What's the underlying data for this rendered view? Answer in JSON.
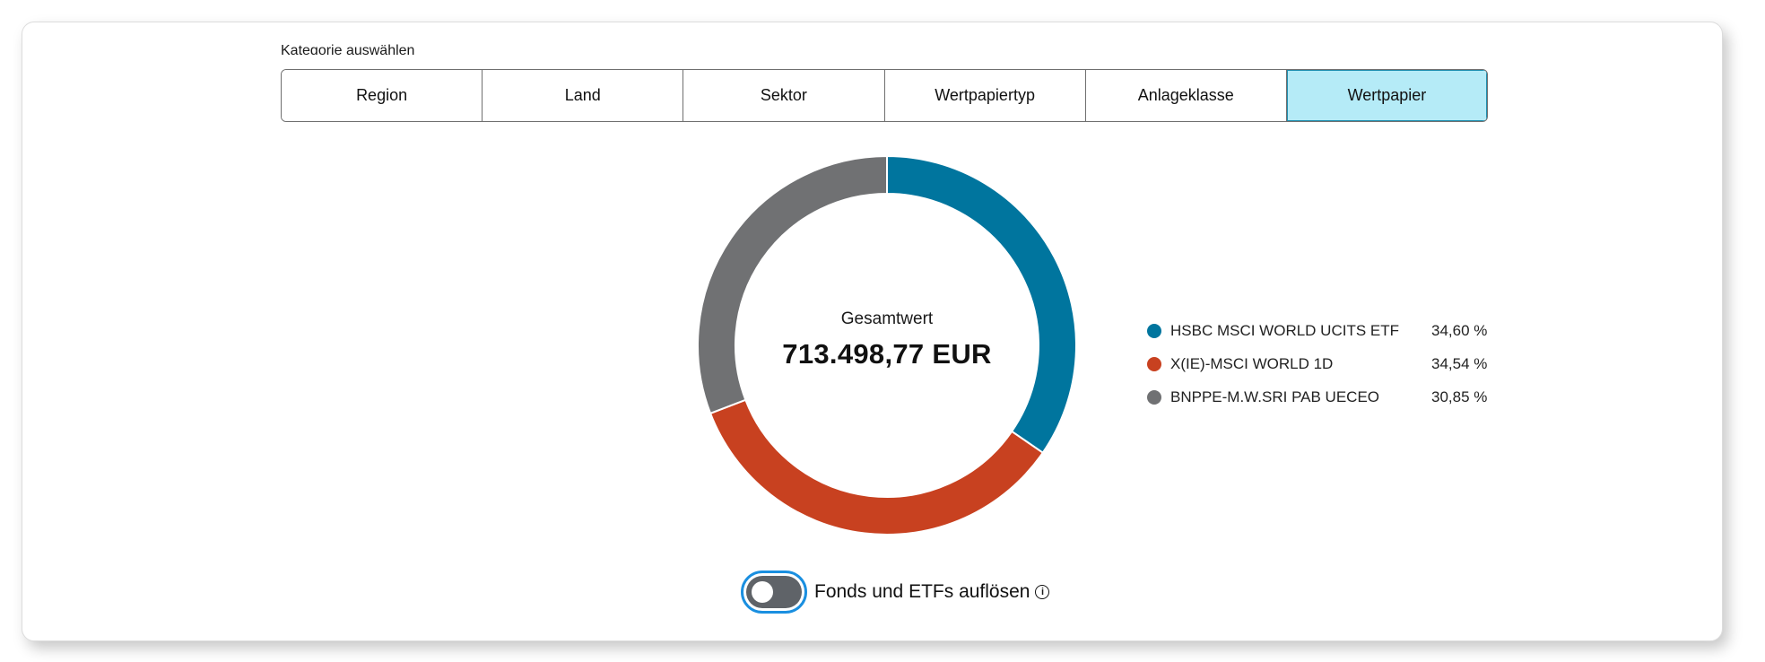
{
  "category": {
    "label": "Kategorie auswählen",
    "tabs": [
      {
        "label": "Region",
        "active": false
      },
      {
        "label": "Land",
        "active": false
      },
      {
        "label": "Sektor",
        "active": false
      },
      {
        "label": "Wertpapiertyp",
        "active": false
      },
      {
        "label": "Anlageklasse",
        "active": false
      },
      {
        "label": "Wertpapier",
        "active": true
      }
    ]
  },
  "chart": {
    "center_label": "Gesamtwert",
    "center_value": "713.498,77 EUR"
  },
  "legend": [
    {
      "name": "HSBC MSCI WORLD UCITS ETF",
      "percent": "34,60 %",
      "color": "#00759e"
    },
    {
      "name": "X(IE)-MSCI WORLD 1D",
      "percent": "34,54 %",
      "color": "#c84120"
    },
    {
      "name": "BNPPE-M.W.SRI PAB UECEO",
      "percent": "30,85 %",
      "color": "#707173"
    }
  ],
  "toggle": {
    "label": "Fonds und ETFs auflösen",
    "checked": false,
    "info_icon": "info-icon"
  },
  "chart_data": {
    "type": "pie",
    "categories": [
      "HSBC MSCI WORLD UCITS ETF",
      "X(IE)-MSCI WORLD 1D",
      "BNPPE-M.W.SRI PAB UECEO"
    ],
    "values": [
      34.6,
      34.54,
      30.85
    ],
    "colors": [
      "#00759e",
      "#c84120",
      "#707173"
    ],
    "donut": true
  }
}
